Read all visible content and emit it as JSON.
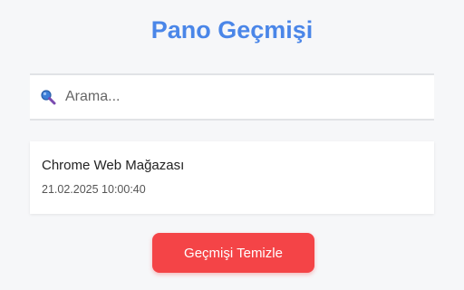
{
  "header": {
    "title": "Pano Geçmişi"
  },
  "search": {
    "placeholder": "Arama...",
    "value": "",
    "icon": "magnifier-icon"
  },
  "history": {
    "items": [
      {
        "title": "Chrome Web Mağazası",
        "timestamp": "21.02.2025 10:00:40"
      }
    ]
  },
  "actions": {
    "clear_label": "Geçmişi Temizle"
  },
  "colors": {
    "accent": "#4a86e8",
    "danger": "#f44447",
    "background": "#f6f7f9"
  }
}
